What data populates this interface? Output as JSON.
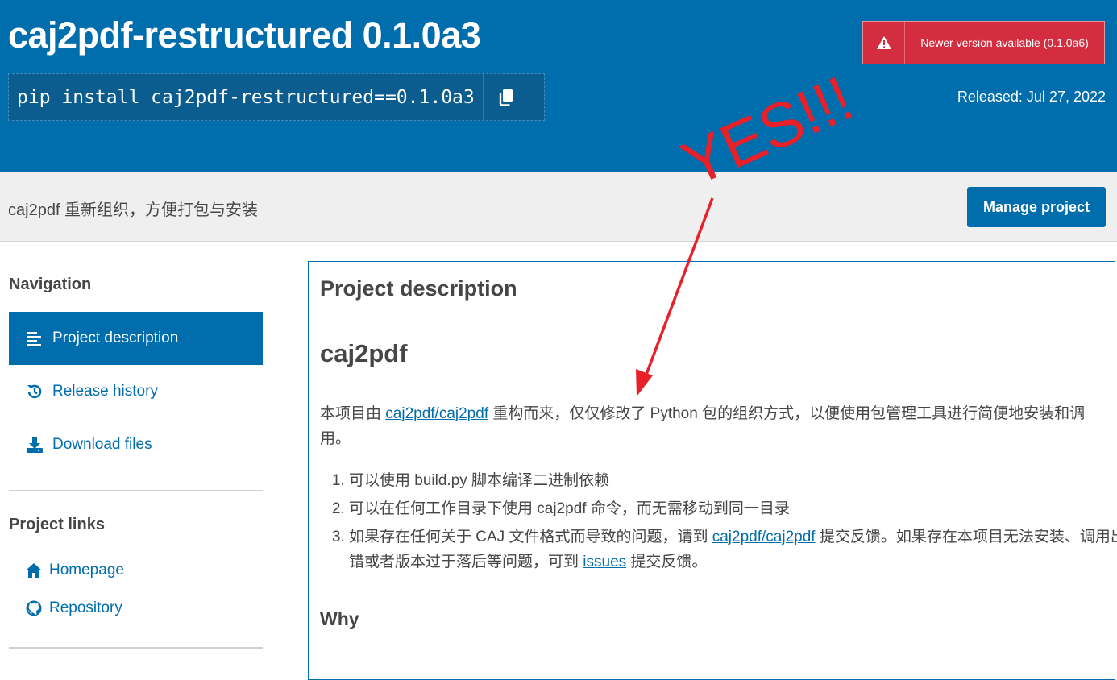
{
  "header": {
    "title": "caj2pdf-restructured 0.1.0a3",
    "pip_command": "pip install caj2pdf-restructured==0.1.0a3",
    "newer_version_alert": "Newer version available (0.1.0a6)",
    "released": "Released: Jul 27, 2022"
  },
  "summary": {
    "text": "caj2pdf 重新组织，方便打包与安装",
    "manage_button": "Manage project"
  },
  "sidebar": {
    "navigation_heading": "Navigation",
    "nav_items": [
      {
        "label": "Project description",
        "icon": "align-left-icon",
        "active": true
      },
      {
        "label": "Release history",
        "icon": "history-icon",
        "active": false
      },
      {
        "label": "Download files",
        "icon": "download-icon",
        "active": false
      }
    ],
    "project_links_heading": "Project links",
    "links": [
      {
        "label": "Homepage",
        "icon": "home-icon"
      },
      {
        "label": "Repository",
        "icon": "github-icon"
      }
    ]
  },
  "main": {
    "section_title": "Project description",
    "readme_title": "caj2pdf",
    "intro_before": "本项目由 ",
    "intro_link": "caj2pdf/caj2pdf",
    "intro_after": " 重构而来，仅仅修改了 Python 包的组织方式，以便使用包管理工具进行简便地安装和调用。",
    "list": {
      "item1": "可以使用 build.py 脚本编译二进制依赖",
      "item2": "可以在任何工作目录下使用 caj2pdf 命令，而无需移动到同一目录",
      "item3_before": "如果存在任何关于 CAJ 文件格式而导致的问题，请到 ",
      "item3_link1": "caj2pdf/caj2pdf",
      "item3_middle": " 提交反馈。如果存在本项目无法安装、调用出错或者版本过于落后等问题，可到 ",
      "item3_link2": "issues",
      "item3_after": " 提交反馈。"
    },
    "why_heading": "Why"
  },
  "annotation": {
    "text": "YES!!!",
    "color": "#e8202a"
  },
  "colors": {
    "brand_blue": "#006dad",
    "alert_red": "#d52d40",
    "band_gray": "#efefef"
  }
}
